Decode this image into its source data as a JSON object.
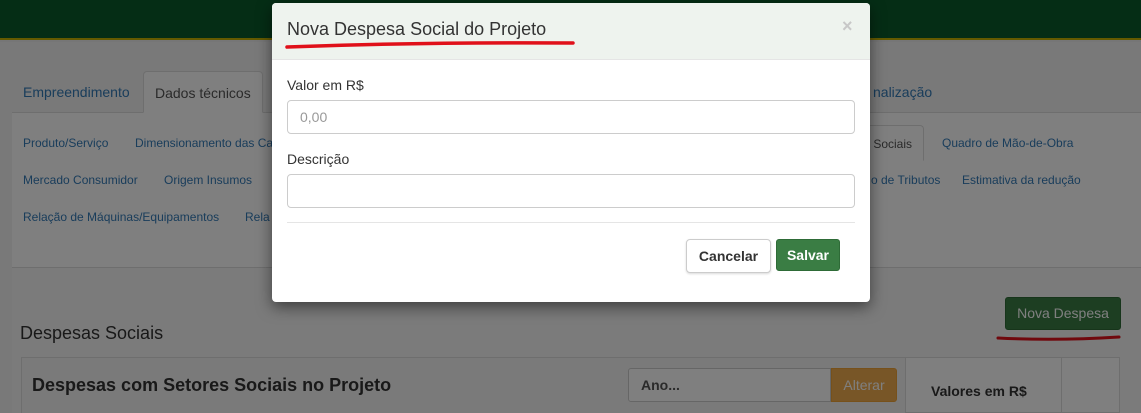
{
  "background": {
    "main_tabs": [
      "Empreendimento",
      "Dados técnicos",
      "nalização"
    ],
    "sub_tabs_row1": [
      "Produto/Serviço",
      "Dimensionamento das Ca",
      "s Sociais",
      "Quadro de Mão-de-Obra"
    ],
    "sub_tabs_row2": [
      "Mercado Consumidor",
      "Origem Insumos",
      "o de Tributos",
      "Estimativa da redução"
    ],
    "sub_tabs_row3": [
      "Relação de Máquinas/Equipamentos",
      "Rela"
    ],
    "section_title": "Despesas Sociais",
    "new_button_label": "Nova Despesa",
    "table": {
      "title": "Despesas com Setores Sociais no Projeto",
      "year_placeholder": "Ano...",
      "alter_label": "Alterar",
      "values_header": "Valores em R$"
    }
  },
  "modal": {
    "title": "Nova Despesa Social do Projeto",
    "close_symbol": "×",
    "value_label": "Valor em R$",
    "value_placeholder": "0,00",
    "description_label": "Descrição",
    "description_placeholder": "",
    "cancel_label": "Cancelar",
    "save_label": "Salvar"
  },
  "colors": {
    "topbar": "#0b5a2a",
    "primary_green": "#3a7d44",
    "warning_orange": "#f0ad4e",
    "annotation_red": "#e0101a"
  }
}
